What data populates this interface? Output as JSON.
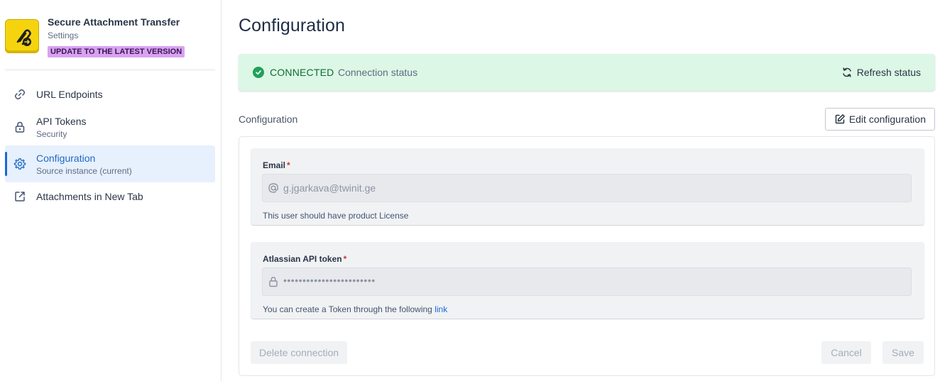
{
  "app": {
    "title": "Secure Attachment Transfer",
    "subtitle": "Settings",
    "update_badge": "UPDATE TO THE LATEST VERSION",
    "logo_icon": "attachment-transfer-icon",
    "accent_color": "#f5d40f"
  },
  "sidebar": {
    "items": [
      {
        "label": "URL Endpoints",
        "sublabel": "",
        "icon": "link-icon",
        "active": false
      },
      {
        "label": "API Tokens",
        "sublabel": "Security",
        "icon": "lock-icon",
        "active": false
      },
      {
        "label": "Configuration",
        "sublabel": "Source instance (current)",
        "icon": "gear-icon",
        "active": true
      },
      {
        "label": "Attachments in New Tab",
        "sublabel": "",
        "icon": "external-link-icon",
        "active": false
      }
    ]
  },
  "main": {
    "page_title": "Configuration",
    "status": {
      "state": "CONNECTED",
      "text": "Connection status",
      "refresh_label": "Refresh status",
      "color": "#21a05a"
    },
    "section_title": "Configuration",
    "edit_label": "Edit configuration",
    "email": {
      "label": "Email",
      "value": "g.jgarkava@twinit.ge",
      "help": "This user should have product License"
    },
    "token": {
      "label": "Atlassian API token",
      "value": "••••••••••••••••••••••••",
      "help_prefix": "You can create a Token through the following",
      "help_link": "link"
    },
    "buttons": {
      "delete": "Delete connection",
      "cancel": "Cancel",
      "save": "Save"
    }
  }
}
